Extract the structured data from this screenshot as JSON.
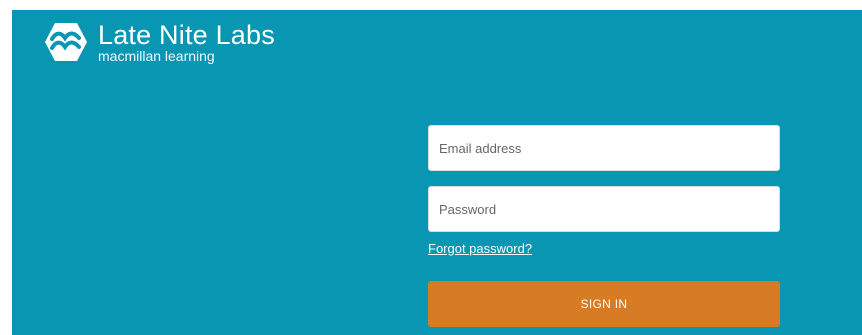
{
  "brand": {
    "name": "Late Nite Labs",
    "subtitle": "macmillan learning",
    "logo_icon": "macmillan-hexagon-icon"
  },
  "login_form": {
    "email_placeholder": "Email address",
    "password_placeholder": "Password",
    "forgot_password_label": "Forgot password?",
    "sign_in_label": "SIGN IN"
  },
  "colors": {
    "panel_background": "#0996b3",
    "sign_in_button": "#d87b25",
    "text_light": "#ffffff"
  }
}
